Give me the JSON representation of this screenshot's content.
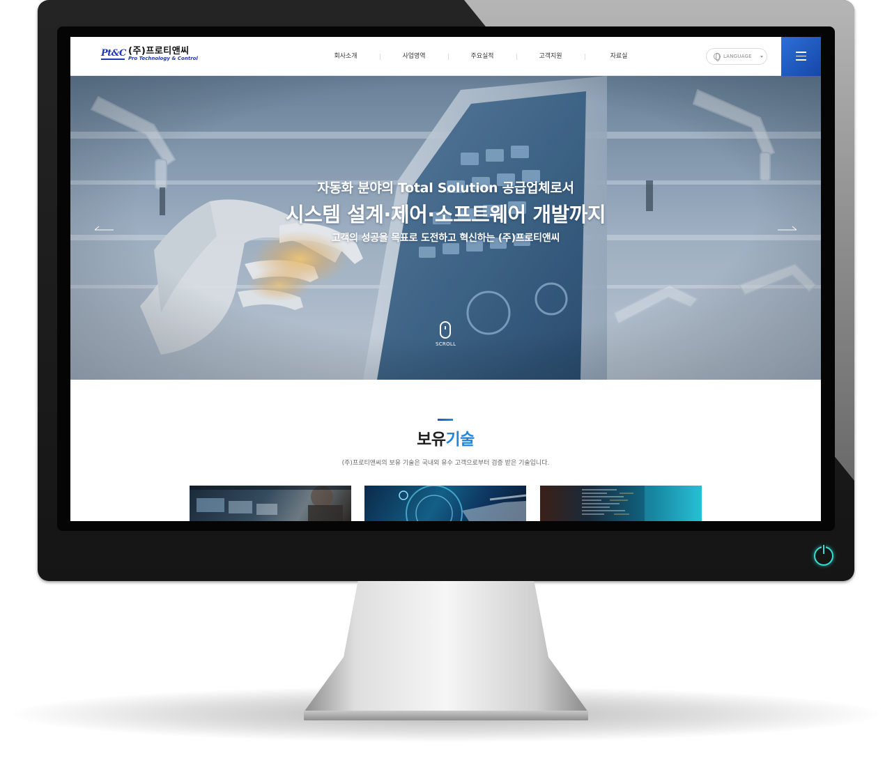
{
  "site": {
    "logo_mark": "Pt&C",
    "logo_name": "(주)프로티앤씨",
    "logo_sub": "Pro Technology & Control"
  },
  "nav": {
    "items": [
      {
        "label": "회사소개"
      },
      {
        "label": "사업영역"
      },
      {
        "label": "주요실적"
      },
      {
        "label": "고객지원"
      },
      {
        "label": "자료실"
      }
    ],
    "language_label": "LANGUAGE"
  },
  "hero": {
    "line1": "자동화 분야의 Total Solution 공급업체로서",
    "line2": "시스템 설계·제어·소프트웨어 개발까지",
    "line3": "고객의 성공을 목표로 도전하고 혁신하는 (주)프로티앤씨",
    "scroll_label": "SCROLL"
  },
  "tech": {
    "title_main": "보유",
    "title_accent": "기술",
    "description": "(주)프로티앤씨의 보유 기술은 국내외 유수 고객으로부터 검증 받은 기술입니다."
  },
  "colors": {
    "brand_blue": "#2136b8",
    "accent_blue": "#1f85e0",
    "menu_button": "#1f5cc4",
    "power_led": "#35e0d2"
  }
}
